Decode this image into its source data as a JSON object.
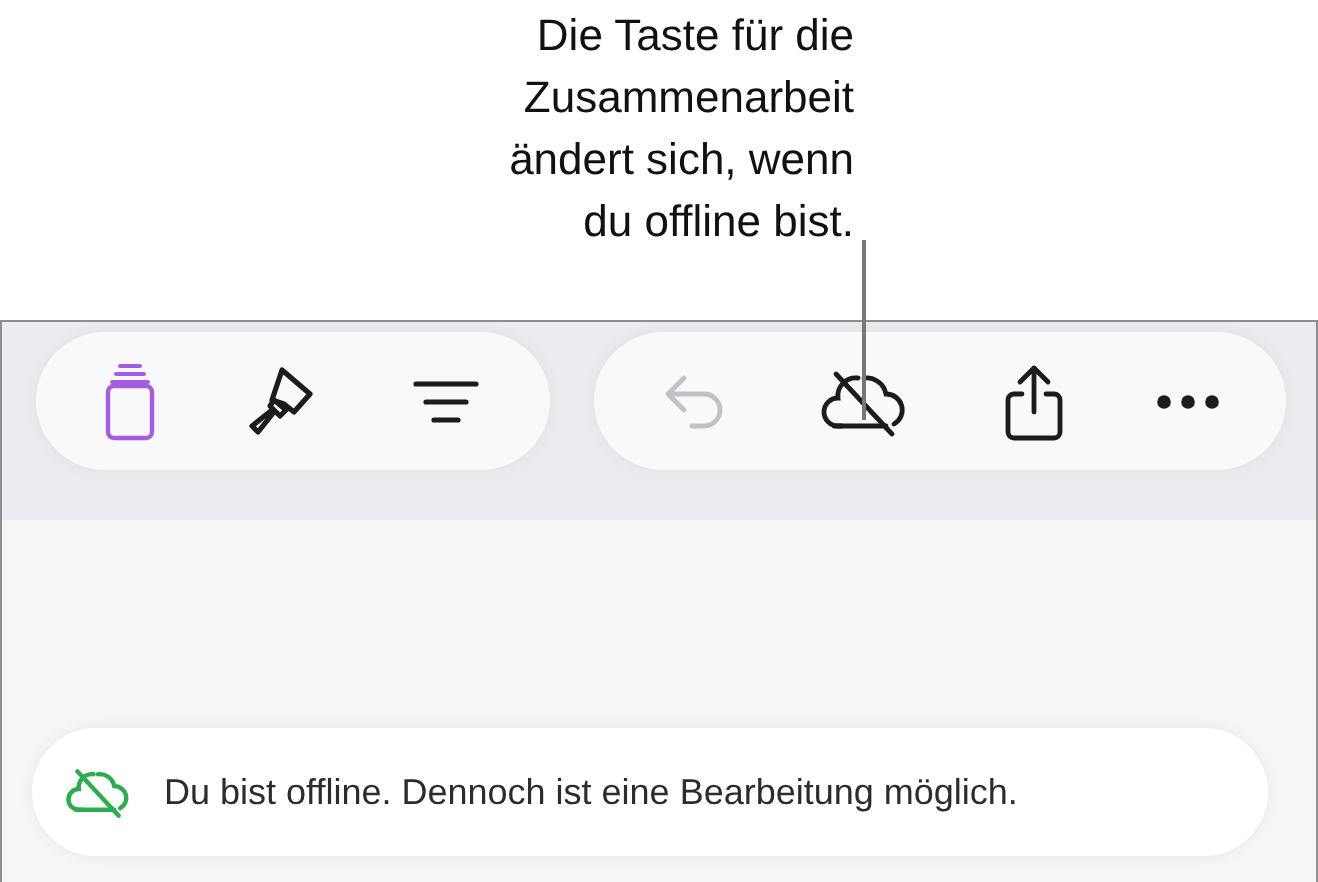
{
  "callout": {
    "lines": [
      "Die Taste für die",
      "Zusammenarbeit",
      "ändert sich, wenn",
      "du offline bist."
    ]
  },
  "toolbar_left": [
    {
      "kind": "pages",
      "active": true
    },
    {
      "kind": "brush",
      "active": false
    },
    {
      "kind": "format",
      "active": false
    }
  ],
  "toolbar_right": [
    {
      "kind": "undo",
      "disabled": true
    },
    {
      "kind": "cloud-offline",
      "disabled": false
    },
    {
      "kind": "share",
      "disabled": false
    },
    {
      "kind": "more",
      "disabled": false
    }
  ],
  "banner": {
    "text": "Du bist offline. Dennoch ist eine Bearbeitung möglich."
  }
}
